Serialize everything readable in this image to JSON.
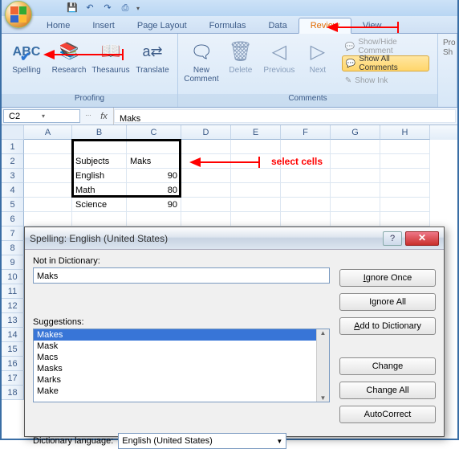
{
  "qat": {
    "save": "💾",
    "undo": "↶",
    "redo": "↷",
    "print": "⎙"
  },
  "tabs": [
    "Home",
    "Insert",
    "Page Layout",
    "Formulas",
    "Data",
    "Review",
    "View"
  ],
  "active_tab": "Review",
  "ribbon": {
    "proofing": {
      "label": "Proofing",
      "spelling": "Spelling",
      "research": "Research",
      "thesaurus": "Thesaurus",
      "translate": "Translate"
    },
    "comments": {
      "label": "Comments",
      "new": "New\nComment",
      "delete": "Delete",
      "previous": "Previous",
      "next": "Next",
      "showhide": "Show/Hide Comment",
      "showall": "Show All Comments",
      "showink": "Show Ink"
    },
    "changes": {
      "pr": "Pro",
      "sh": "Sh"
    }
  },
  "namebox": "C2",
  "formula": "Maks",
  "columns": [
    "A",
    "B",
    "C",
    "D",
    "E",
    "F",
    "G",
    "H"
  ],
  "grid": {
    "b2": "Subjects",
    "c2": "Maks",
    "b3": "English",
    "c3": "90",
    "b4": "Math",
    "c4": "80",
    "b5": "Science",
    "c5": "90"
  },
  "annotation": "select cells",
  "dialog": {
    "title": "Spelling: English (United States)",
    "not_in_dict_label": "Not in Dictionary:",
    "not_in_dict_value": "Maks",
    "suggestions_label": "Suggestions:",
    "suggestions": [
      "Makes",
      "Mask",
      "Macs",
      "Masks",
      "Marks",
      "Make"
    ],
    "ignore_once": "Ignore Once",
    "ignore_all": "Ignore All",
    "add_dict": "Add to Dictionary",
    "change": "Change",
    "change_all": "Change All",
    "autocorrect": "AutoCorrect",
    "lang_label": "Dictionary language:",
    "lang_value": "English (United States)"
  }
}
